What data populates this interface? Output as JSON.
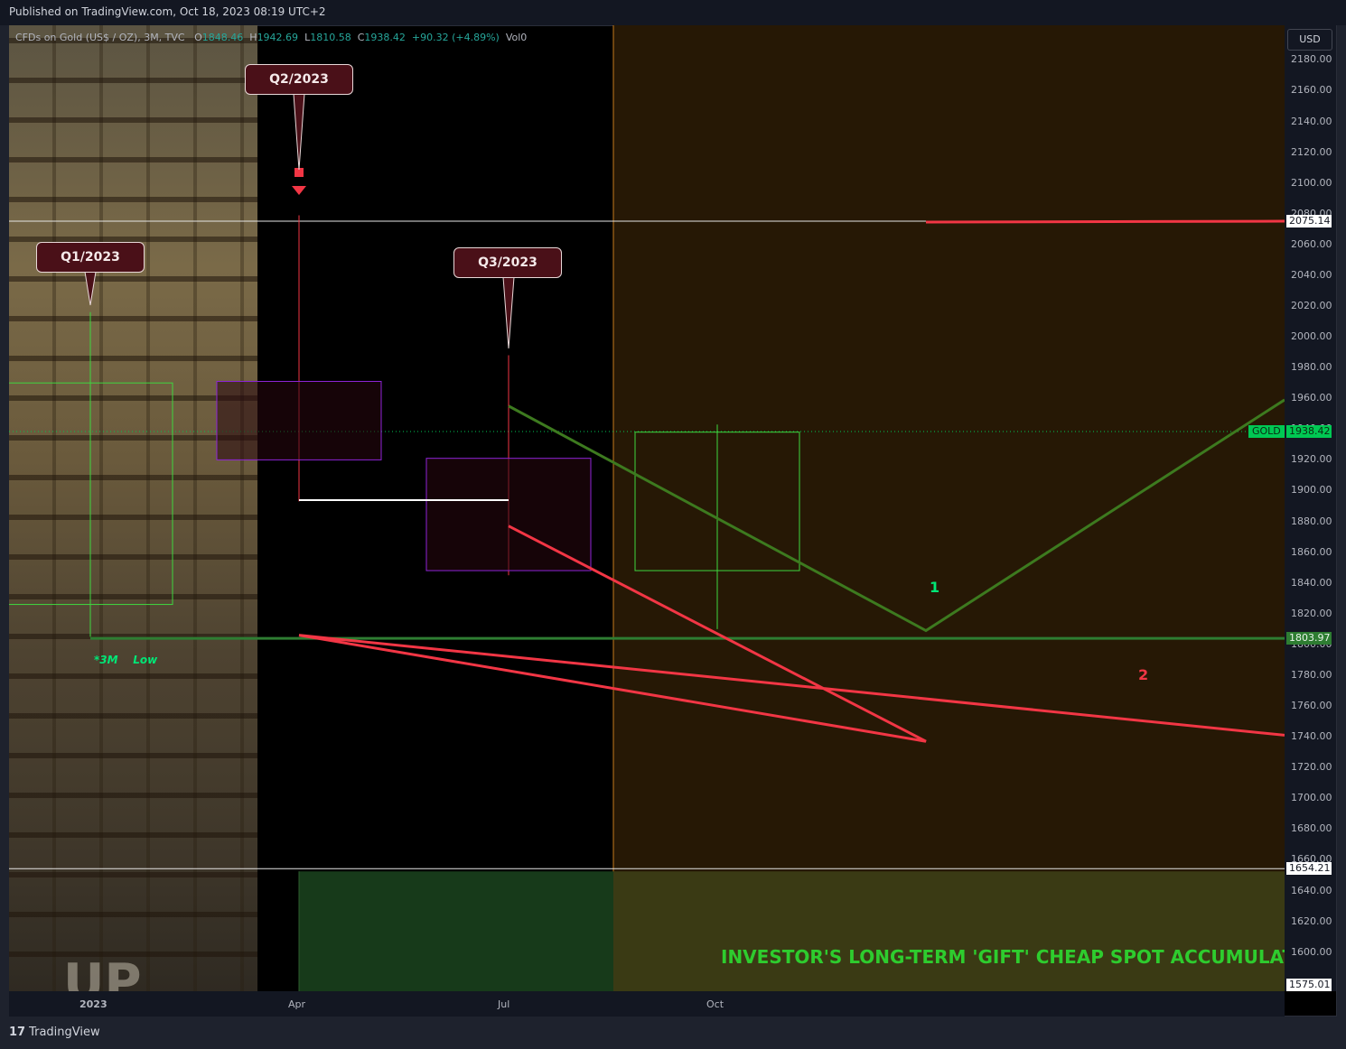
{
  "header": {
    "published": "Published on TradingView.com, Oct 18, 2023 08:19 UTC+2",
    "symbol": "CFDs on Gold (US$ / OZ), 3M, TVC",
    "ohlc": {
      "o": "1848.46",
      "h": "1942.69",
      "l": "1810.58",
      "c": "1938.42",
      "change": "+90.32 (+4.89%)",
      "vol": "Vol0"
    },
    "labels": {
      "o": "O",
      "h": "H",
      "l": "L",
      "c": "C"
    }
  },
  "currency": "USD",
  "footer": {
    "brand": "TradingView",
    "logo": "tv-logo-icon"
  },
  "chart_data": {
    "type": "candlestick",
    "y_ticks": [
      "2180.00",
      "2160.00",
      "2140.00",
      "2120.00",
      "2100.00",
      "2080.00",
      "2060.00",
      "2040.00",
      "2020.00",
      "2000.00",
      "1980.00",
      "1960.00",
      "1940.00",
      "1920.00",
      "1900.00",
      "1880.00",
      "1860.00",
      "1840.00",
      "1820.00",
      "1800.00",
      "1780.00",
      "1760.00",
      "1740.00",
      "1720.00",
      "1700.00",
      "1680.00",
      "1660.00",
      "1640.00",
      "1620.00",
      "1600.00"
    ],
    "x_ticks": [
      "2023",
      "Apr",
      "Jul",
      "Oct"
    ],
    "candles": [
      {
        "period": "2023",
        "open": 1826,
        "high": 2016,
        "low": 1805,
        "close": 1970,
        "color": "green"
      },
      {
        "period": "Apr",
        "open": 1971,
        "high": 2079,
        "low": 1893,
        "close": 1920,
        "color": "purple"
      },
      {
        "period": "Jul",
        "open": 1921,
        "high": 1988,
        "low": 1845,
        "close": 1848,
        "color": "purple"
      },
      {
        "period": "Oct",
        "open": 1848,
        "high": 1943,
        "low": 1810,
        "close": 1938,
        "color": "green"
      }
    ],
    "price_labels": {
      "resistance": "2075.14",
      "last": "1938.42",
      "last_symbol": "GOLD",
      "support": "1803.97",
      "zone_top": "1654.21",
      "zone_bottom": "1575.01"
    },
    "projections": [
      {
        "name": "1",
        "color": "#3d7a1f",
        "points": [
          [
            "Jul",
            1955
          ],
          [
            "Jan",
            1809
          ],
          [
            "end",
            1959
          ]
        ]
      },
      {
        "name": "2",
        "color": "#f23645",
        "points": [
          [
            "Jul",
            1877
          ],
          [
            "Jan",
            1737
          ],
          [
            "Apr",
            1806
          ],
          [
            "end",
            1741
          ]
        ]
      }
    ],
    "callouts": [
      "Q1/2023",
      "Q2/2023",
      "Q3/2023"
    ],
    "annotations": {
      "low_label": "*3M    Low",
      "wave1": "1",
      "wave2": "2",
      "zone_text": "INVESTOR'S LONG-TERM 'GIFT' CHEAP SPOT ACCUMULAT"
    },
    "y_range": [
      1575,
      2190
    ]
  }
}
